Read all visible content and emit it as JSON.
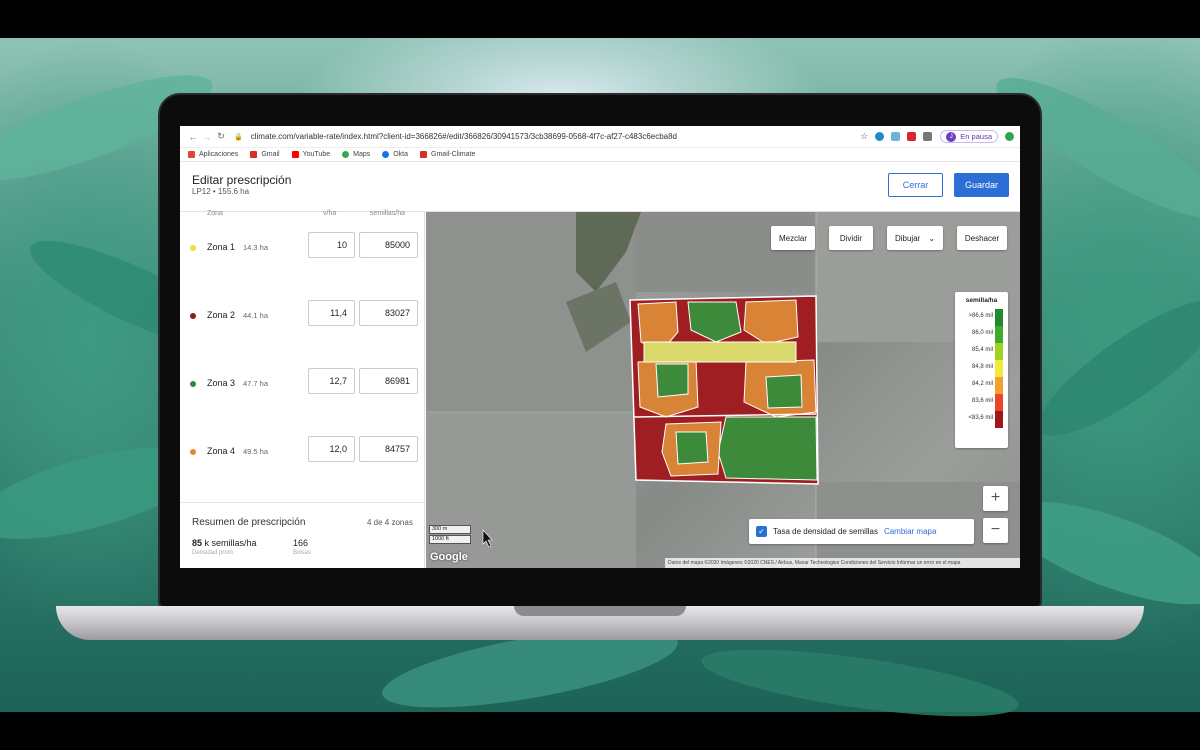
{
  "browser": {
    "url": "climate.com/variable-rate/index.html?client-id=366826#/edit/366826/30941573/3cb38699-0568-4f7c-af27-c483c6ecba8d",
    "profile_initial": "J",
    "profile_status": "En pausa",
    "bookmarks": [
      {
        "label": "Aplicaciones",
        "icon": "grid-icon",
        "color": "#e0453a"
      },
      {
        "label": "Gmail",
        "icon": "gmail-icon",
        "color": "#d93025"
      },
      {
        "label": "YouTube",
        "icon": "youtube-icon",
        "color": "#ff0000"
      },
      {
        "label": "Maps",
        "icon": "maps-pin-icon",
        "color": "#34a853"
      },
      {
        "label": "Okta",
        "icon": "okta-icon",
        "color": "#1a73e8"
      },
      {
        "label": "Gmail-Climate",
        "icon": "gmail-icon",
        "color": "#d93025"
      }
    ]
  },
  "header": {
    "title": "Editar prescripción",
    "subtitle": "LP12 • 155.6 ha",
    "close_label": "Cerrar",
    "save_label": "Guardar"
  },
  "panel": {
    "col_zone": "Zona",
    "col_rate": "v/ha",
    "col_seeds": "semillas/ha",
    "zones": [
      {
        "name": "Zona 1",
        "area": "14.3 ha",
        "rate": "10",
        "seeds": "85000",
        "color": "#f0e033"
      },
      {
        "name": "Zona 2",
        "area": "44.1 ha",
        "rate": "11,4",
        "seeds": "83027",
        "color": "#8b1a1a"
      },
      {
        "name": "Zona 3",
        "area": "47.7 ha",
        "rate": "12,7",
        "seeds": "86981",
        "color": "#2e8b3a"
      },
      {
        "name": "Zona 4",
        "area": "49.5 ha",
        "rate": "12,0",
        "seeds": "84757",
        "color": "#e8862b"
      }
    ],
    "summary": {
      "title": "Resumen de prescripción",
      "count": "4 de 4 zonas",
      "density_value": "85",
      "density_unit": "k semillas/ha",
      "density_label": "Densidad prom.",
      "bags_value": "166",
      "bags_label": "Bolsas"
    }
  },
  "map": {
    "controls": {
      "merge": "Mezclar",
      "split": "Dividir",
      "draw": "Dibujar",
      "undo": "Deshacer"
    },
    "legend": {
      "title": "semilla/ha",
      "items": [
        {
          "label": ">86,6 mil",
          "color": "#1f8a2e"
        },
        {
          "label": "86,0 mil",
          "color": "#3faa2e"
        },
        {
          "label": "85,4 mil",
          "color": "#9ed321"
        },
        {
          "label": "84,8 mil",
          "color": "#f2e93b"
        },
        {
          "label": "84,2 mil",
          "color": "#f2a12b"
        },
        {
          "label": "83,6 mil",
          "color": "#e8452b"
        },
        {
          "label": "<83,6 mil",
          "color": "#a0161b"
        }
      ]
    },
    "density_label": "Tasa de densidad de semillas",
    "change_map": "Cambiar mapa",
    "zoom_in": "+",
    "zoom_out": "−",
    "scale_m": "300 m",
    "scale_ft": "1000 ft",
    "google": "Google",
    "attribution": "Datos del mapa ©2020 Imágenes ©2020 CNES / Airbus, Maxar Technologies   Condiciones del Servicio   Informar un error en el mapa"
  }
}
